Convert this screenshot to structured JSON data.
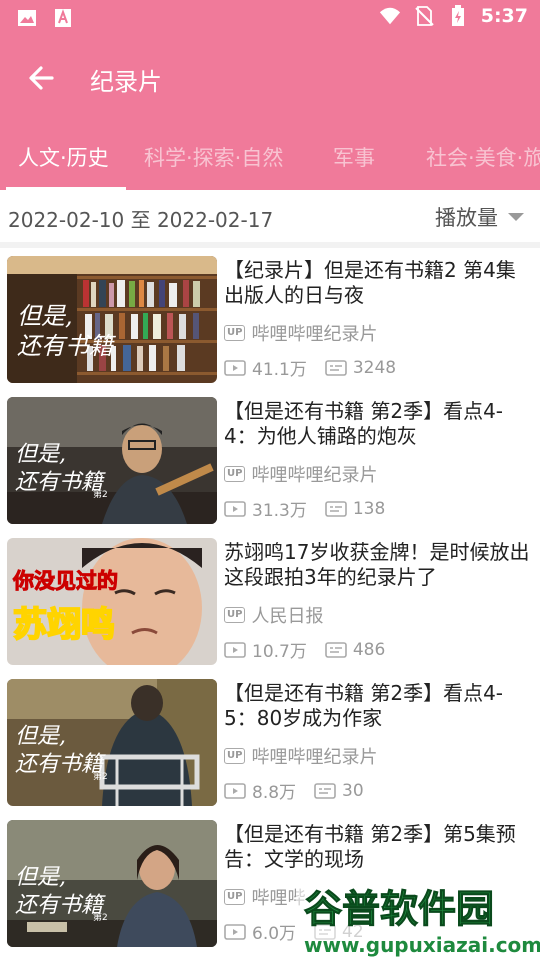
{
  "status_bar": {
    "time": "5:37",
    "icons": [
      "image-icon",
      "text-a-icon",
      "wifi-icon",
      "no-sim-icon",
      "battery-charging-icon"
    ]
  },
  "header": {
    "title": "纪录片",
    "back_icon": "arrow-left-icon"
  },
  "tabs": [
    {
      "label": "人文·历史",
      "active": true
    },
    {
      "label": "科学·探索·自然",
      "active": false
    },
    {
      "label": "军事",
      "active": false
    },
    {
      "label": "社会·美食·旅",
      "active": false
    }
  ],
  "filter": {
    "date_range": "2022-02-10 至 2022-02-17",
    "sort_label": "播放量"
  },
  "videos": [
    {
      "title": "【纪录片】但是还有书籍2 第4集 出版人的日与夜",
      "uploader": "哔哩哔哩纪录片",
      "up_badge": "UP",
      "views": "41.1万",
      "comments": "3248"
    },
    {
      "title": "【但是还有书籍 第2季】看点4-4：为他人铺路的炮灰",
      "uploader": "哔哩哔哩纪录片",
      "up_badge": "UP",
      "views": "31.3万",
      "comments": "138"
    },
    {
      "title": "苏翊鸣17岁收获金牌！是时候放出这段跟拍3年的纪录片了",
      "uploader": "人民日报",
      "up_badge": "UP",
      "views": "10.7万",
      "comments": "486"
    },
    {
      "title": "【但是还有书籍 第2季】看点4-5：80岁成为作家",
      "uploader": "哔哩哔哩纪录片",
      "up_badge": "UP",
      "views": "8.8万",
      "comments": "30"
    },
    {
      "title": "【但是还有书籍 第2季】第5集预告：文学的现场",
      "uploader": "哔哩哔",
      "up_badge": "UP",
      "views": "6.0万",
      "comments": "42"
    }
  ],
  "thumbnails": {
    "overlay_text": "但是，还有书籍",
    "overlay_sub": "第2",
    "promo_line1": "你没见过的",
    "promo_line2": "苏翊鸣"
  },
  "watermark": {
    "main": "谷普软件园",
    "url": "www.gupuxiazai.com"
  },
  "colors": {
    "accent": "#f07a9a",
    "muted_text": "#999999"
  }
}
